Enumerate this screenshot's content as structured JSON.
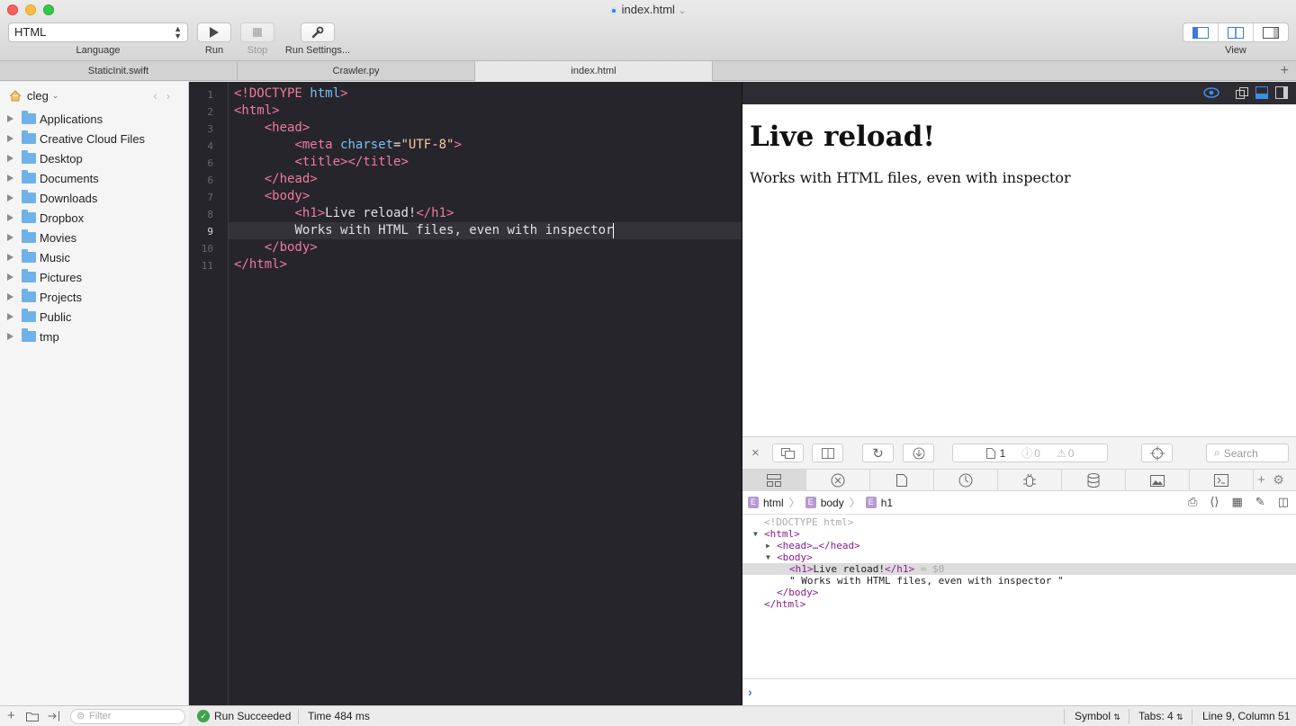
{
  "window": {
    "title": "index.html"
  },
  "toolbar": {
    "language_value": "HTML",
    "language_caption": "Language",
    "run_caption": "Run",
    "stop_caption": "Stop",
    "run_settings_caption": "Run Settings...",
    "view_caption": "View"
  },
  "tabs": [
    {
      "label": "StaticInit.swift"
    },
    {
      "label": "Crawler.py"
    },
    {
      "label": "index.html",
      "active": true
    }
  ],
  "sidebar": {
    "root": "cleg",
    "items": [
      {
        "label": "Applications"
      },
      {
        "label": "Creative Cloud Files"
      },
      {
        "label": "Desktop"
      },
      {
        "label": "Documents"
      },
      {
        "label": "Downloads"
      },
      {
        "label": "Dropbox"
      },
      {
        "label": "Movies"
      },
      {
        "label": "Music"
      },
      {
        "label": "Pictures"
      },
      {
        "label": "Projects"
      },
      {
        "label": "Public"
      },
      {
        "label": "tmp"
      }
    ],
    "filter_placeholder": "Filter"
  },
  "editor": {
    "line_numbers": [
      "1",
      "2",
      "3",
      "4",
      "6",
      "6",
      "7",
      "8",
      "9",
      "10",
      "11"
    ],
    "current_line": "9",
    "code": {
      "l1_tag": "<!DOCTYPE",
      "l1_word": "html",
      "l1_close": ">",
      "l2": "<html>",
      "l3": "<head>",
      "l4_tag": "<meta",
      "l4_attr": "charset",
      "l4_eq": "=",
      "l4_val": "\"UTF-8\"",
      "l4_close": ">",
      "l5_open": "<title>",
      "l5_close": "</title>",
      "l6": "</head>",
      "l7": "<body>",
      "l8_open": "<h1>",
      "l8_text": "Live reload!",
      "l8_close": "</h1>",
      "l9_text": "Works with HTML files, even with inspector",
      "l10": "</body>",
      "l11": "</html>"
    }
  },
  "preview": {
    "heading": "Live reload!",
    "paragraph": "Works with HTML files, even with inspector"
  },
  "inspector": {
    "page_count": "1",
    "errors": "0",
    "warnings": "0",
    "search_placeholder": "Search",
    "breadcrumb": [
      "html",
      "body",
      "h1"
    ],
    "dom": {
      "doctype": "<!DOCTYPE html>",
      "html_open": "<html>",
      "head_collapsed": "<head>…</head>",
      "body_open": "<body>",
      "h1_open": "<h1>",
      "h1_text": "Live reload!",
      "h1_close": "</h1>",
      "h1_ref": " = $0",
      "text_node": "\" Works with HTML files, even with inspector \"",
      "body_close": "</body>",
      "html_close": "</html>"
    }
  },
  "statusbar": {
    "run_status": "Run Succeeded",
    "time": "Time 484 ms",
    "symbol": "Symbol",
    "tabs": "Tabs: 4",
    "position": "Line 9, Column 51"
  },
  "colors": {
    "editor_bg": "#26252b",
    "tag": "#f07aa0",
    "attr": "#7ac0f0",
    "string": "#f3c9a2",
    "success": "#3fa34d"
  }
}
